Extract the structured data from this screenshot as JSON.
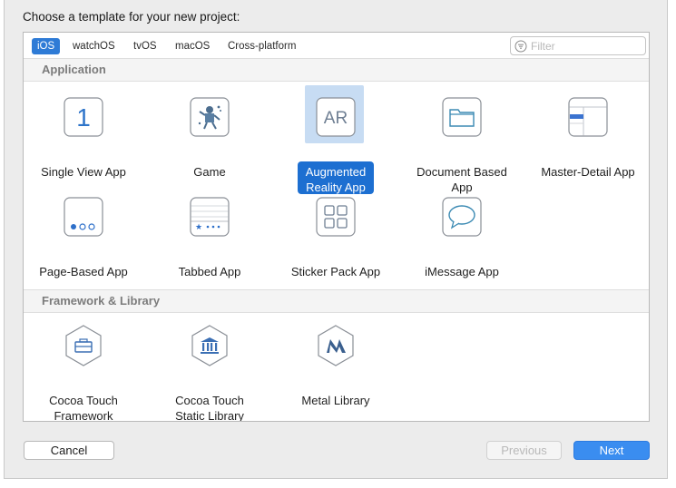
{
  "dialog": {
    "prompt": "Choose a template for your new project:"
  },
  "tabs": [
    {
      "label": "iOS",
      "active": true
    },
    {
      "label": "watchOS",
      "active": false
    },
    {
      "label": "tvOS",
      "active": false
    },
    {
      "label": "macOS",
      "active": false
    },
    {
      "label": "Cross-platform",
      "active": false
    }
  ],
  "filter": {
    "placeholder": "Filter",
    "value": ""
  },
  "sections": [
    {
      "title": "Application",
      "templates": [
        {
          "label": "Single View App",
          "icon": "single-view-icon",
          "glyph": "1"
        },
        {
          "label": "Game",
          "icon": "game-icon"
        },
        {
          "label": "Augmented Reality App",
          "icon": "ar-icon",
          "glyph": "AR",
          "selected": true
        },
        {
          "label": "Document Based App",
          "icon": "folder-icon"
        },
        {
          "label": "Master-Detail App",
          "icon": "master-detail-icon"
        },
        {
          "label": "Page-Based App",
          "icon": "page-dots-icon"
        },
        {
          "label": "Tabbed App",
          "icon": "tab-bar-icon"
        },
        {
          "label": "Sticker Pack App",
          "icon": "sticker-grid-icon"
        },
        {
          "label": "iMessage App",
          "icon": "speech-bubble-icon"
        }
      ]
    },
    {
      "title": "Framework & Library",
      "templates": [
        {
          "label": "Cocoa Touch Framework",
          "icon": "toolbox-icon"
        },
        {
          "label": "Cocoa Touch Static Library",
          "icon": "building-columns-icon"
        },
        {
          "label": "Metal Library",
          "icon": "metal-icon"
        }
      ]
    }
  ],
  "buttons": {
    "cancel": "Cancel",
    "previous": "Previous",
    "next": "Next"
  },
  "colors": {
    "accent": "#2e7bd6",
    "selection_tile": "#c7dcf3",
    "selection_label": "#1d6fd1",
    "next_button": "#3a8df0"
  }
}
